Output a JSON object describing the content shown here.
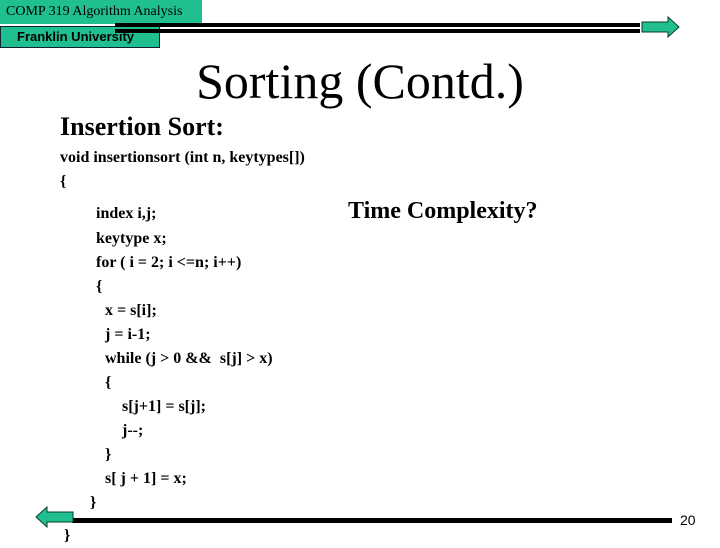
{
  "header": {
    "course": "COMP 319 Algorithm Analysis",
    "university": "Franklin University",
    "accent_color": "#1fbf8f"
  },
  "navigation": {
    "next_icon": "arrow-right-icon",
    "prev_icon": "arrow-left-icon"
  },
  "slide": {
    "title": "Sorting (Contd.)",
    "section_title": "Insertion Sort:",
    "question": "Time Complexity?",
    "code": [
      "void insertionsort (int n, keytypes[])",
      "{",
      "index i,j;",
      "keytype x;",
      "for ( i = 2; i <=n; i++)",
      "{",
      "x = s[i];",
      "j = i-1;",
      "while (j > 0 &&  s[j] > x)",
      "{",
      "s[j+1] = s[j];",
      "j--;",
      "}",
      "s[ j + 1] = x;",
      "}",
      "}"
    ],
    "page_number": "20"
  }
}
